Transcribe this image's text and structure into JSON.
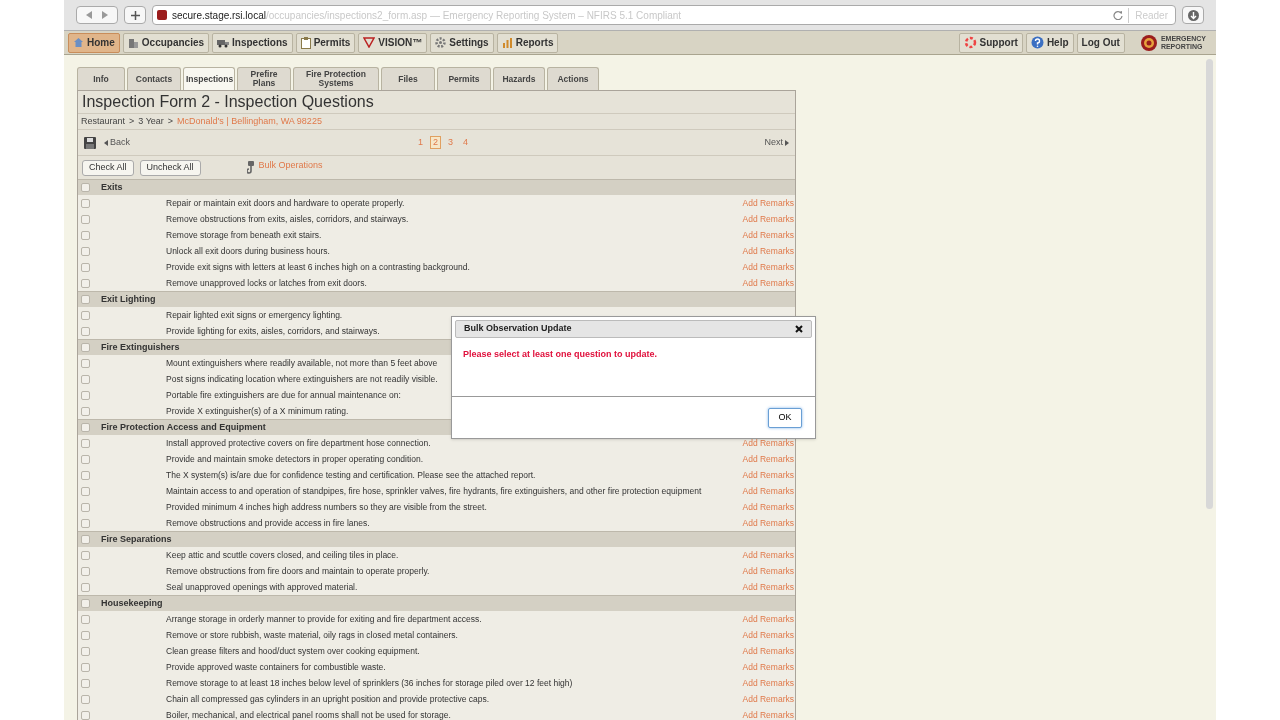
{
  "browser": {
    "url_host": "secure.stage.rsi.local",
    "url_rest": "/occupancies/inspections2_form.asp — Emergency Reporting System – NFIRS 5.1 Compliant",
    "reader": "Reader"
  },
  "nav": {
    "left": [
      {
        "label": "Home",
        "selected": true
      },
      {
        "label": "Occupancies",
        "selected": false
      },
      {
        "label": "Inspections",
        "selected": false
      },
      {
        "label": "Permits",
        "selected": false
      },
      {
        "label": "VISION™",
        "selected": false
      },
      {
        "label": "Settings",
        "selected": false
      },
      {
        "label": "Reports",
        "selected": false
      }
    ],
    "right": [
      "Support",
      "Help",
      "Log Out"
    ],
    "logo": [
      "EMERGENCY",
      "REPORTING"
    ]
  },
  "tabs": [
    {
      "label": "Info",
      "selected": false
    },
    {
      "label": "Contacts",
      "selected": false
    },
    {
      "label": "Inspections",
      "selected": true
    },
    {
      "label": "Prefire Plans",
      "selected": false
    },
    {
      "label": "Fire Protection Systems",
      "selected": false
    },
    {
      "label": "Files",
      "selected": false
    },
    {
      "label": "Permits",
      "selected": false
    },
    {
      "label": "Hazards",
      "selected": false
    },
    {
      "label": "Actions",
      "selected": false
    }
  ],
  "form": {
    "title": "Inspection Form 2 - Inspection Questions",
    "breadcrumb": [
      {
        "text": "Restaurant",
        "kind": "crumb"
      },
      {
        "text": ">",
        "kind": "sep"
      },
      {
        "text": "3 Year",
        "kind": "crumb"
      },
      {
        "text": ">",
        "kind": "sep"
      },
      {
        "text": "McDonald's | Bellingham, WA 98225",
        "kind": "link"
      }
    ],
    "back": "Back",
    "next": "Next",
    "pages": [
      {
        "label": "1",
        "selected": false
      },
      {
        "label": "2",
        "selected": true
      },
      {
        "label": "3",
        "selected": false
      },
      {
        "label": "4",
        "selected": false
      }
    ],
    "buttons": [
      "Check All",
      "Uncheck All"
    ],
    "bulk": "Bulk Operations"
  },
  "sections": [
    {
      "title": "Exits",
      "checked": false,
      "items": [
        {
          "text": "Repair or maintain exit doors and hardware to operate properly.",
          "checked": false,
          "remarks": "Add Remarks"
        },
        {
          "text": "Remove obstructions from exits, aisles, corridors, and stairways.",
          "checked": false,
          "remarks": "Add Remarks"
        },
        {
          "text": "Remove storage from beneath exit stairs.",
          "checked": false,
          "remarks": "Add Remarks"
        },
        {
          "text": "Unlock all exit doors during business hours.",
          "checked": false,
          "remarks": "Add Remarks"
        },
        {
          "text": "Provide exit signs with letters at least 6 inches high on a contrasting background.",
          "checked": false,
          "remarks": "Add Remarks"
        },
        {
          "text": "Remove unapproved locks or latches from exit doors.",
          "checked": false,
          "remarks": "Add Remarks"
        }
      ]
    },
    {
      "title": "Exit Lighting",
      "checked": false,
      "items": [
        {
          "text": "Repair lighted exit signs or emergency lighting.",
          "checked": false
        },
        {
          "text": "Provide lighting for exits, aisles, corridors, and stairways.",
          "checked": false
        }
      ]
    },
    {
      "title": "Fire Extinguishers",
      "checked": false,
      "items": [
        {
          "text": "Mount extinguishers where readily available, not more than 5 feet above",
          "checked": false
        },
        {
          "text": "Post signs indicating location where extinguishers are not readily visible.",
          "checked": false
        },
        {
          "text": "Portable fire extinguishers are due for annual maintenance on:",
          "checked": false
        },
        {
          "text": "Provide X extinguisher(s) of a X minimum rating.",
          "checked": false
        }
      ]
    },
    {
      "title": "Fire Protection Access and Equipment",
      "checked": false,
      "items": [
        {
          "text": "Install approved protective covers on fire department hose connection.",
          "checked": false,
          "remarks": "Add Remarks"
        },
        {
          "text": "Provide and maintain smoke detectors in proper operating condition.",
          "checked": false,
          "remarks": "Add Remarks"
        },
        {
          "text": "The X system(s) is/are due for confidence testing and certification. Please see the attached report.",
          "checked": false,
          "remarks": "Add Remarks"
        },
        {
          "text": "Maintain access to and operation of standpipes, fire hose, sprinkler valves, fire hydrants, fire extinguishers, and other fire protection equipment",
          "checked": false,
          "remarks": "Add Remarks"
        },
        {
          "text": "Provided minimum 4 inches high address numbers so they are visible from the street.",
          "checked": false,
          "remarks": "Add Remarks"
        },
        {
          "text": "Remove obstructions and provide access in fire lanes.",
          "checked": false,
          "remarks": "Add Remarks"
        }
      ]
    },
    {
      "title": "Fire Separations",
      "checked": false,
      "items": [
        {
          "text": "Keep attic and scuttle covers closed, and ceiling tiles in place.",
          "checked": false,
          "remarks": "Add Remarks"
        },
        {
          "text": "Remove obstructions from fire doors and maintain to operate properly.",
          "checked": false,
          "remarks": "Add Remarks"
        },
        {
          "text": "Seal unapproved openings with approved material.",
          "checked": false,
          "remarks": "Add Remarks"
        }
      ]
    },
    {
      "title": "Housekeeping",
      "checked": false,
      "items": [
        {
          "text": "Arrange storage in orderly manner to provide for exiting and fire department access.",
          "checked": false,
          "remarks": "Add Remarks"
        },
        {
          "text": "Remove or store rubbish, waste material, oily rags in closed metal containers.",
          "checked": false,
          "remarks": "Add Remarks"
        },
        {
          "text": "Clean grease filters and hood/duct system over cooking equipment.",
          "checked": false,
          "remarks": "Add Remarks"
        },
        {
          "text": "Provide approved waste containers for combustible waste.",
          "checked": false,
          "remarks": "Add Remarks"
        },
        {
          "text": "Remove storage to at least 18 inches below level of sprinklers (36 inches for storage piled over 12 feet high)",
          "checked": false,
          "remarks": "Add Remarks"
        },
        {
          "text": "Chain all compressed gas cylinders in an upright position and provide protective caps.",
          "checked": false,
          "remarks": "Add Remarks"
        },
        {
          "text": "Boiler, mechanical, and electrical panel rooms shall not be used for storage.",
          "checked": false,
          "remarks": "Add Remarks"
        }
      ]
    }
  ],
  "dialog": {
    "title": "Bulk Observation Update",
    "message": "Please select at least one question to update.",
    "ok": "OK"
  }
}
